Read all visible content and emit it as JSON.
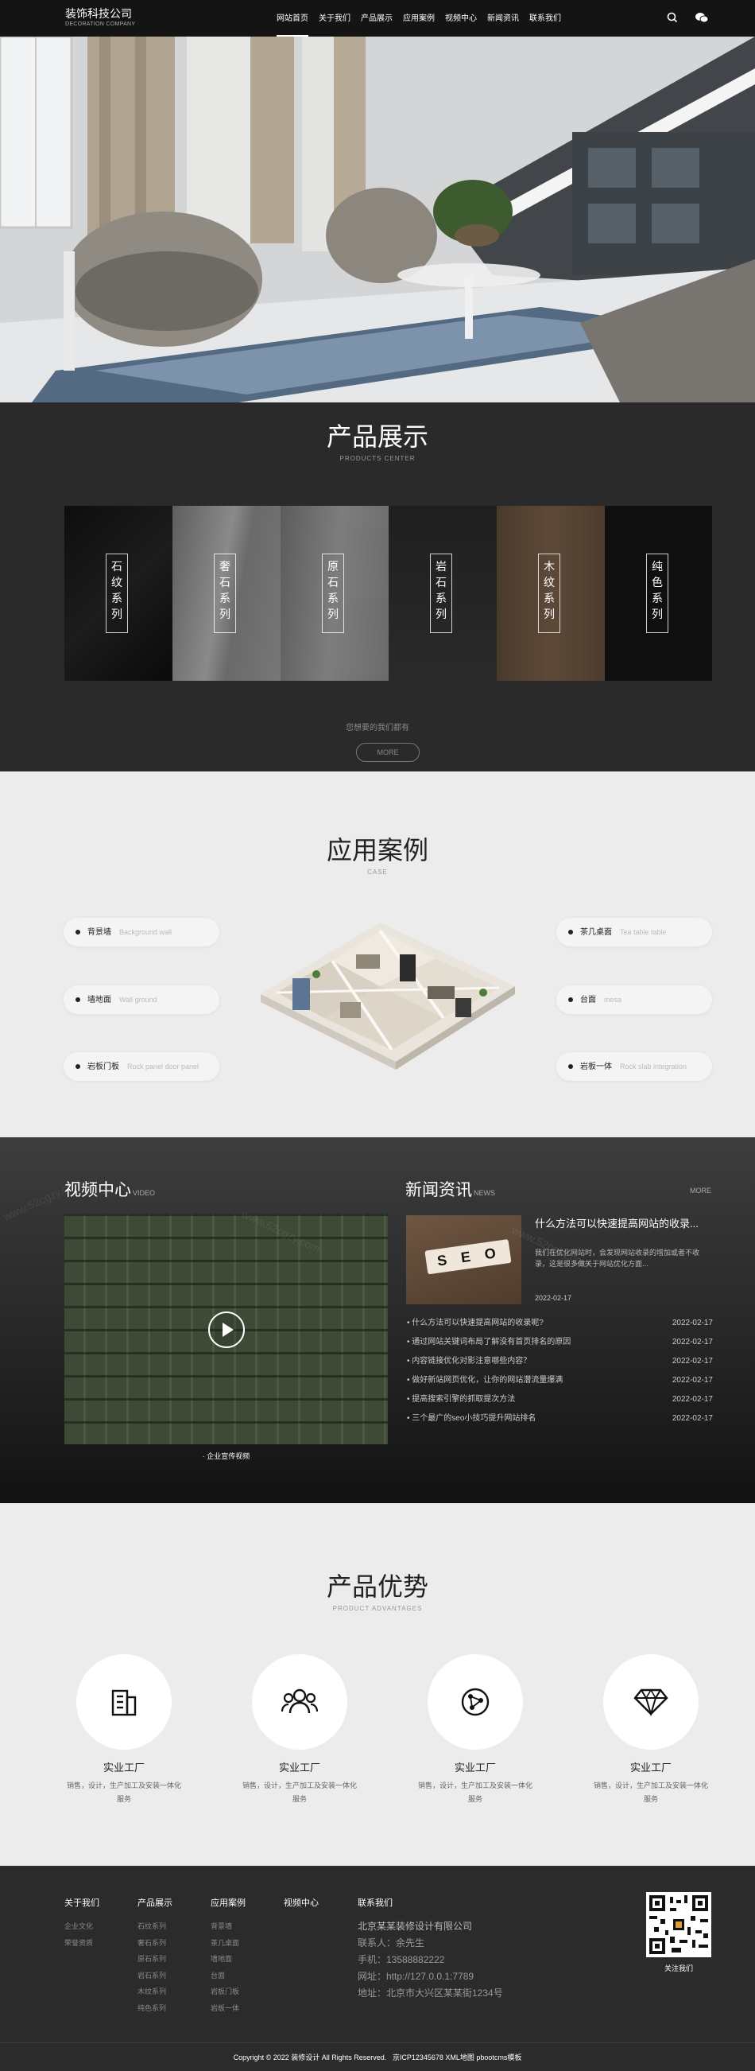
{
  "header": {
    "logo_title": "装饰科技公司",
    "logo_sub": "DECORATION COMPANY",
    "nav": [
      "网站首页",
      "关于我们",
      "产品展示",
      "应用案例",
      "视频中心",
      "新闻资讯",
      "联系我们"
    ]
  },
  "products": {
    "title": "产品展示",
    "subtitle": "PRODUCTS CENTER",
    "items": [
      "石纹系列",
      "奢石系列",
      "原石系列",
      "岩石系列",
      "木纹系列",
      "纯色系列"
    ],
    "tagline": "您想要的我们都有",
    "more": "MORE"
  },
  "cases": {
    "title": "应用案例",
    "subtitle": "CASE",
    "left": [
      {
        "cn": "背景墙",
        "en": "Background wall"
      },
      {
        "cn": "墙地面",
        "en": "Wall ground"
      },
      {
        "cn": "岩板门板",
        "en": "Rock panel door panel"
      }
    ],
    "right": [
      {
        "cn": "茶几桌面",
        "en": "Tea table table"
      },
      {
        "cn": "台面",
        "en": "mesa"
      },
      {
        "cn": "岩板一体",
        "en": "Rock slab integration"
      }
    ]
  },
  "video": {
    "title": "视频中心",
    "sub": "VIDEO",
    "caption": "· 企业宣传视频",
    "watermark": "www.52cgzy.com"
  },
  "news": {
    "title": "新闻资讯",
    "sub": "NEWS",
    "more": "MORE",
    "featured_title": "什么方法可以快速提高网站的收录...",
    "featured_desc": "我们在优化网站时，会发现网站收录的增加或者不收录，这是很多做关于网站优化方面...",
    "featured_date": "2022-02-17",
    "seo_text": "SEO",
    "items": [
      {
        "t": "• 什么方法可以快速提高网站的收录呢?",
        "d": "2022-02-17"
      },
      {
        "t": "• 通过网站关键词布局了解没有首页排名的原因",
        "d": "2022-02-17"
      },
      {
        "t": "• 内容链接优化对影注意哪些内容？",
        "d": "2022-02-17"
      },
      {
        "t": "• 做好新站网页优化，让你的网站潜流量爆满",
        "d": "2022-02-17"
      },
      {
        "t": "• 提高搜索引擎的抓取提次方法",
        "d": "2022-02-17"
      },
      {
        "t": "• 三个最广的seo小技巧提升网站排名",
        "d": "2022-02-17"
      }
    ]
  },
  "advantages": {
    "title": "产品优势",
    "subtitle": "PRODUCT ADVANTAGES",
    "items": [
      {
        "title": "实业工厂",
        "desc": "销售，设计，生产加工及安装一体化服务",
        "icon": "building-icon"
      },
      {
        "title": "实业工厂",
        "desc": "销售，设计，生产加工及安装一体化服务",
        "icon": "users-icon"
      },
      {
        "title": "实业工厂",
        "desc": "销售，设计，生产加工及安装一体化服务",
        "icon": "network-globe-icon"
      },
      {
        "title": "实业工厂",
        "desc": "销售，设计，生产加工及安装一体化服务",
        "icon": "diamond-icon"
      }
    ]
  },
  "footer": {
    "cols": [
      {
        "h": "关于我们",
        "items": [
          "企业文化",
          "荣誉资质"
        ]
      },
      {
        "h": "产品展示",
        "items": [
          "石纹系列",
          "奢石系列",
          "原石系列",
          "岩石系列",
          "木纹系列",
          "纯色系列"
        ]
      },
      {
        "h": "应用案例",
        "items": [
          "背景墙",
          "茶几桌面",
          "墙地面",
          "台面",
          "岩板门板",
          "岩板一体"
        ]
      },
      {
        "h": "视频中心",
        "items": []
      }
    ],
    "contact_h": "联系我们",
    "company": "北京某某装修设计有限公司",
    "contact": [
      "联系人：余先生",
      "手机：13588882222",
      "网址：http://127.0.0.1:7789",
      "地址：北京市大兴区某某街1234号"
    ],
    "qr_label": "关注我们",
    "copyright": "Copyright © 2022 装修设计 All Rights Reserved.   京ICP12345678 XML地图 pbootcms模板"
  },
  "colors": {
    "dark": "#2a2a2a",
    "light": "#ececec",
    "accent": "#ffffff"
  }
}
